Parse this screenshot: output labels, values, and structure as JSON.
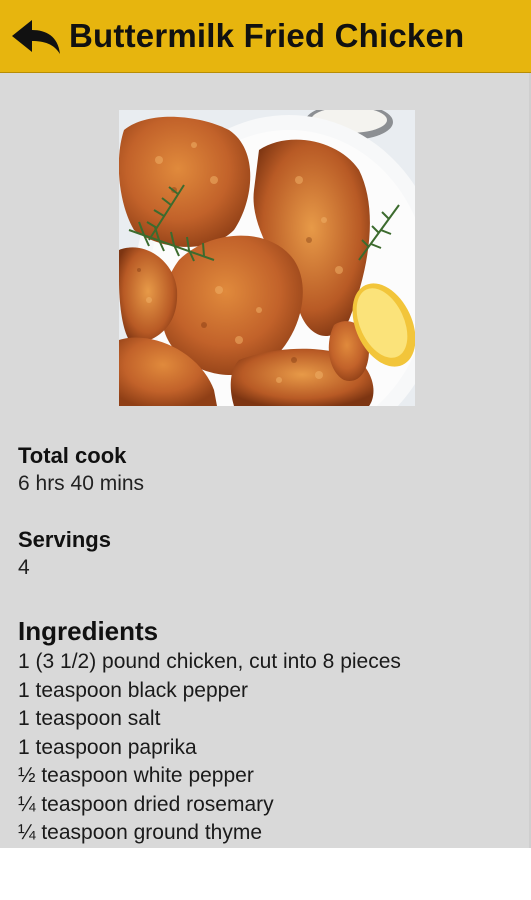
{
  "header": {
    "title": "Buttermilk Fried Chicken",
    "back_icon": "arrow-back-icon",
    "bg_color": "#e7b50e"
  },
  "photo": {
    "subject": "fried-chicken-platter"
  },
  "details": {
    "total_cook_label": "Total cook",
    "total_cook_value": "6 hrs 40 mins",
    "servings_label": "Servings",
    "servings_value": "4"
  },
  "ingredients": {
    "title": "Ingredients",
    "items": [
      "1 (3 1/2) pound chicken, cut into 8 pieces",
      "1 teaspoon black pepper",
      "1 teaspoon salt",
      "1 teaspoon paprika",
      "½ teaspoon white pepper",
      "¼ teaspoon dried rosemary",
      "¼ teaspoon ground thyme"
    ]
  }
}
